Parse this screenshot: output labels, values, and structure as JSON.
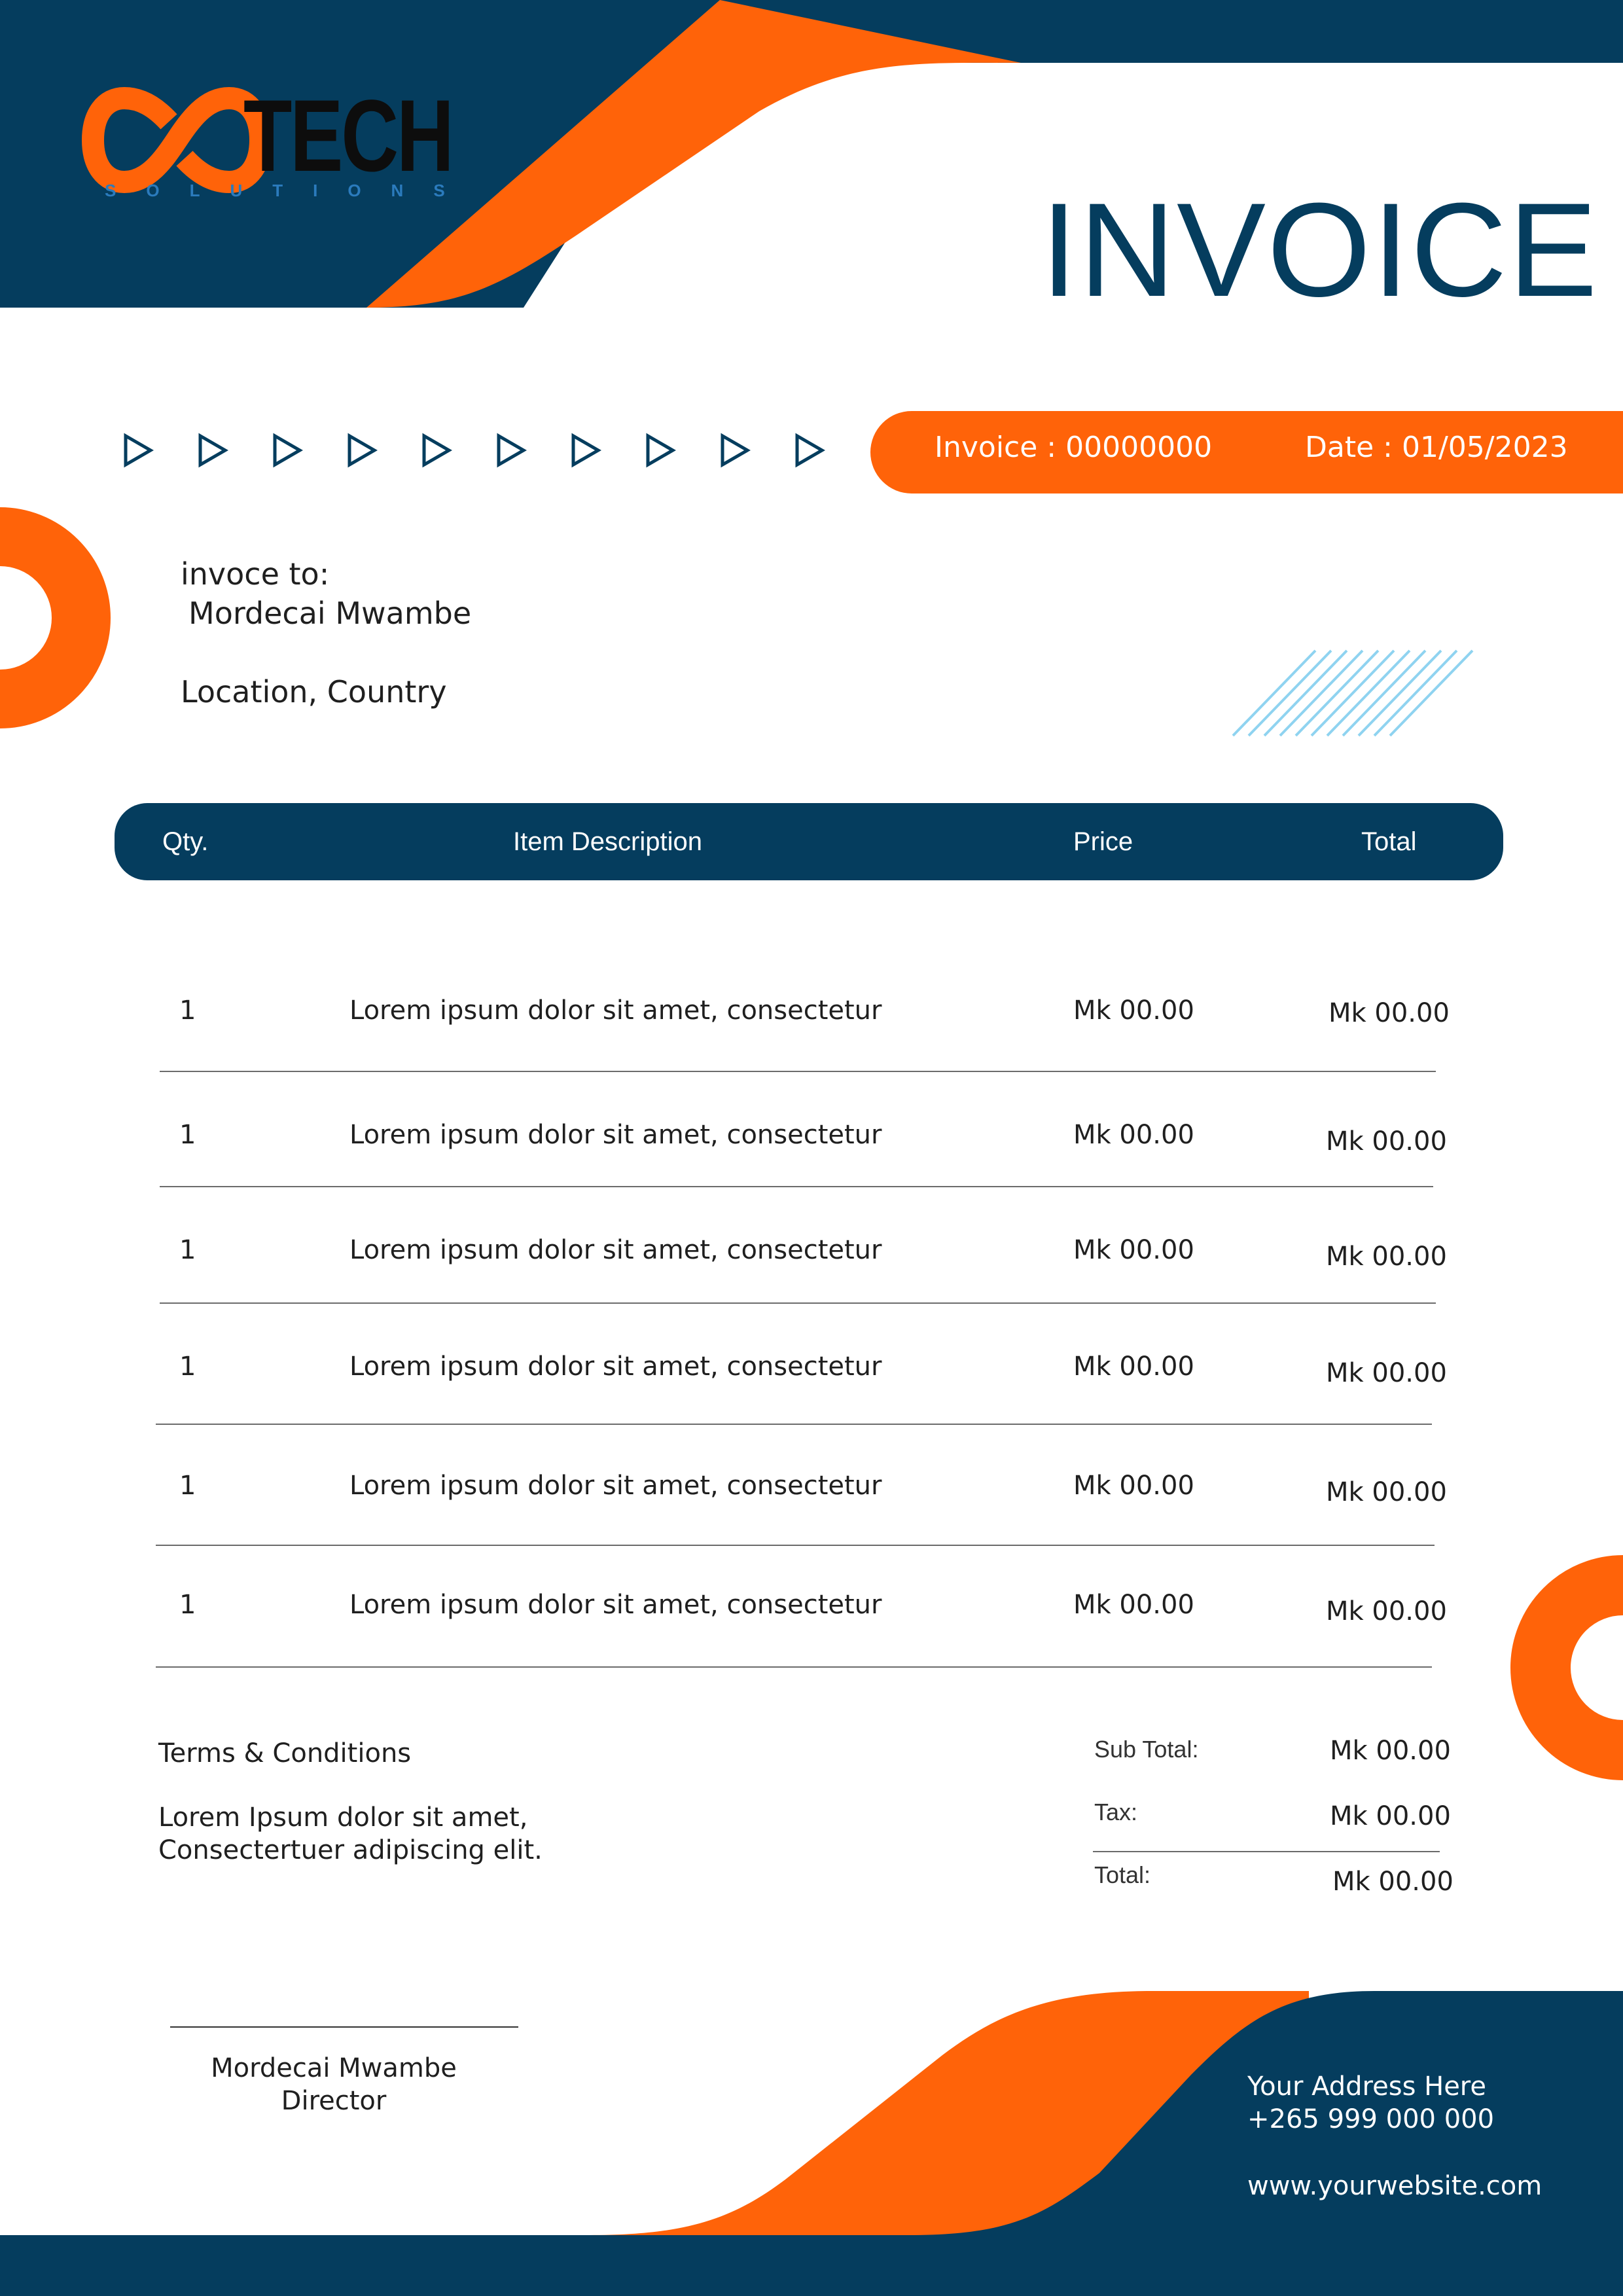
{
  "brand": {
    "name": "TECH",
    "tagline": "SOLUTIONS",
    "colors": {
      "navy": "#053d5e",
      "orange": "#ff6309",
      "lightblue": "#8fd3f0"
    }
  },
  "document": {
    "title": "INVOICE"
  },
  "invoice_info": {
    "number_label": "Invoice : 00000000",
    "date_label": "Date : 01/05/2023"
  },
  "bill_to": {
    "label": "invoce to:",
    "name": "Mordecai Mwambe",
    "location": "Location, Country"
  },
  "table": {
    "headers": {
      "qty": "Qty.",
      "description": "Item Description",
      "price": "Price",
      "total": "Total"
    },
    "rows": [
      {
        "qty": "1",
        "description": "Lorem ipsum dolor sit amet, consectetur",
        "price": "Mk 00.00",
        "total": "Mk 00.00"
      },
      {
        "qty": "1",
        "description": "Lorem ipsum dolor sit amet, consectetur",
        "price": "Mk 00.00",
        "total": "Mk 00.00"
      },
      {
        "qty": "1",
        "description": "Lorem ipsum dolor sit amet, consectetur",
        "price": "Mk 00.00",
        "total": "Mk 00.00"
      },
      {
        "qty": "1",
        "description": "Lorem ipsum dolor sit amet, consectetur",
        "price": "Mk 00.00",
        "total": "Mk 00.00"
      },
      {
        "qty": "1",
        "description": "Lorem ipsum dolor sit amet, consectetur",
        "price": "Mk 00.00",
        "total": "Mk 00.00"
      },
      {
        "qty": "1",
        "description": "Lorem ipsum dolor sit amet, consectetur",
        "price": "Mk 00.00",
        "total": "Mk 00.00"
      }
    ]
  },
  "terms": {
    "title": "Terms & Conditions",
    "line1": "Lorem Ipsum dolor sit amet,",
    "line2": "Consectertuer adipiscing elit."
  },
  "summary": {
    "subtotal_label": "Sub Total:",
    "subtotal_value": "Mk 00.00",
    "tax_label": "Tax:",
    "tax_value": "Mk 00.00",
    "total_label": "Total:",
    "total_value": "Mk 00.00"
  },
  "signature": {
    "name": "Mordecai Mwambe",
    "title": "Director"
  },
  "contact": {
    "address": "Your Address Here",
    "phone": "+265 999 000 000",
    "website": "www.yourwebsite.com"
  },
  "decor": {
    "arrow_icon": "triangle-outline-icon",
    "arrow_count": 10
  }
}
